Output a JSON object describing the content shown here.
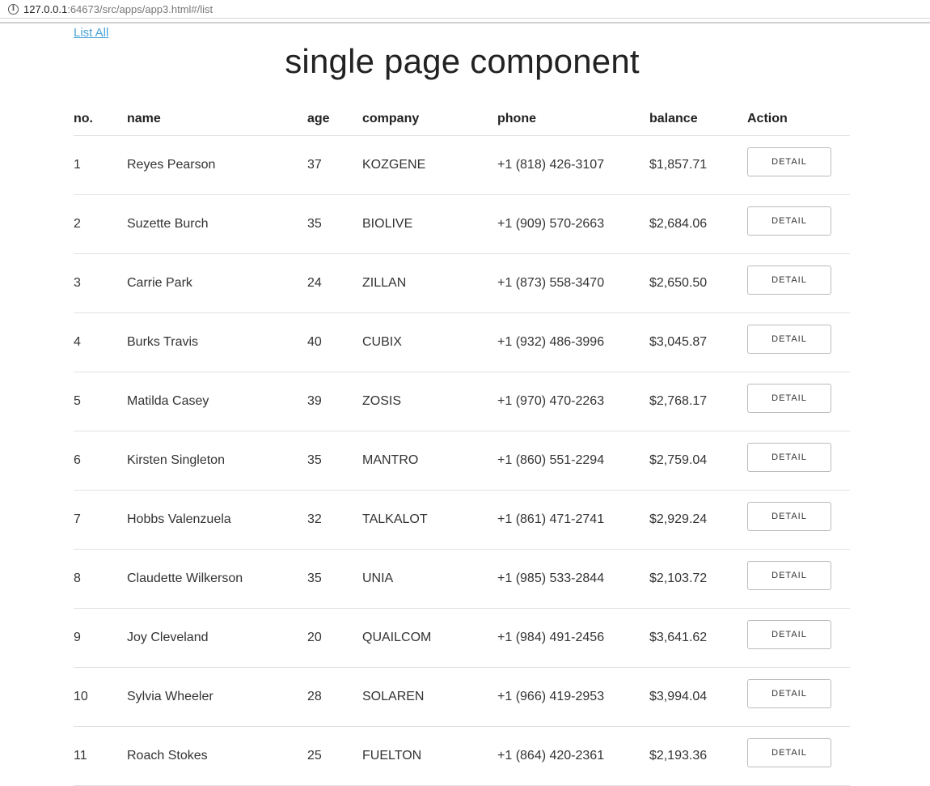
{
  "browser": {
    "url_host": "127.0.0.1",
    "url_rest": ":64673/src/apps/app3.html#/list"
  },
  "nav": {
    "list_all": "List All"
  },
  "page": {
    "title": "single page component"
  },
  "table": {
    "headers": {
      "no": "no.",
      "name": "name",
      "age": "age",
      "company": "company",
      "phone": "phone",
      "balance": "balance",
      "action": "Action"
    },
    "detail_label": "DETAIL",
    "rows": [
      {
        "no": "1",
        "name": "Reyes Pearson",
        "age": "37",
        "company": "KOZGENE",
        "phone": "+1 (818) 426-3107",
        "balance": "$1,857.71"
      },
      {
        "no": "2",
        "name": "Suzette Burch",
        "age": "35",
        "company": "BIOLIVE",
        "phone": "+1 (909) 570-2663",
        "balance": "$2,684.06"
      },
      {
        "no": "3",
        "name": "Carrie Park",
        "age": "24",
        "company": "ZILLAN",
        "phone": "+1 (873) 558-3470",
        "balance": "$2,650.50"
      },
      {
        "no": "4",
        "name": "Burks Travis",
        "age": "40",
        "company": "CUBIX",
        "phone": "+1 (932) 486-3996",
        "balance": "$3,045.87"
      },
      {
        "no": "5",
        "name": "Matilda Casey",
        "age": "39",
        "company": "ZOSIS",
        "phone": "+1 (970) 470-2263",
        "balance": "$2,768.17"
      },
      {
        "no": "6",
        "name": "Kirsten Singleton",
        "age": "35",
        "company": "MANTRO",
        "phone": "+1 (860) 551-2294",
        "balance": "$2,759.04"
      },
      {
        "no": "7",
        "name": "Hobbs Valenzuela",
        "age": "32",
        "company": "TALKALOT",
        "phone": "+1 (861) 471-2741",
        "balance": "$2,929.24"
      },
      {
        "no": "8",
        "name": "Claudette Wilkerson",
        "age": "35",
        "company": "UNIA",
        "phone": "+1 (985) 533-2844",
        "balance": "$2,103.72"
      },
      {
        "no": "9",
        "name": "Joy Cleveland",
        "age": "20",
        "company": "QUAILCOM",
        "phone": "+1 (984) 491-2456",
        "balance": "$3,641.62"
      },
      {
        "no": "10",
        "name": "Sylvia Wheeler",
        "age": "28",
        "company": "SOLAREN",
        "phone": "+1 (966) 419-2953",
        "balance": "$3,994.04"
      },
      {
        "no": "11",
        "name": "Roach Stokes",
        "age": "25",
        "company": "FUELTON",
        "phone": "+1 (864) 420-2361",
        "balance": "$2,193.36"
      }
    ]
  }
}
